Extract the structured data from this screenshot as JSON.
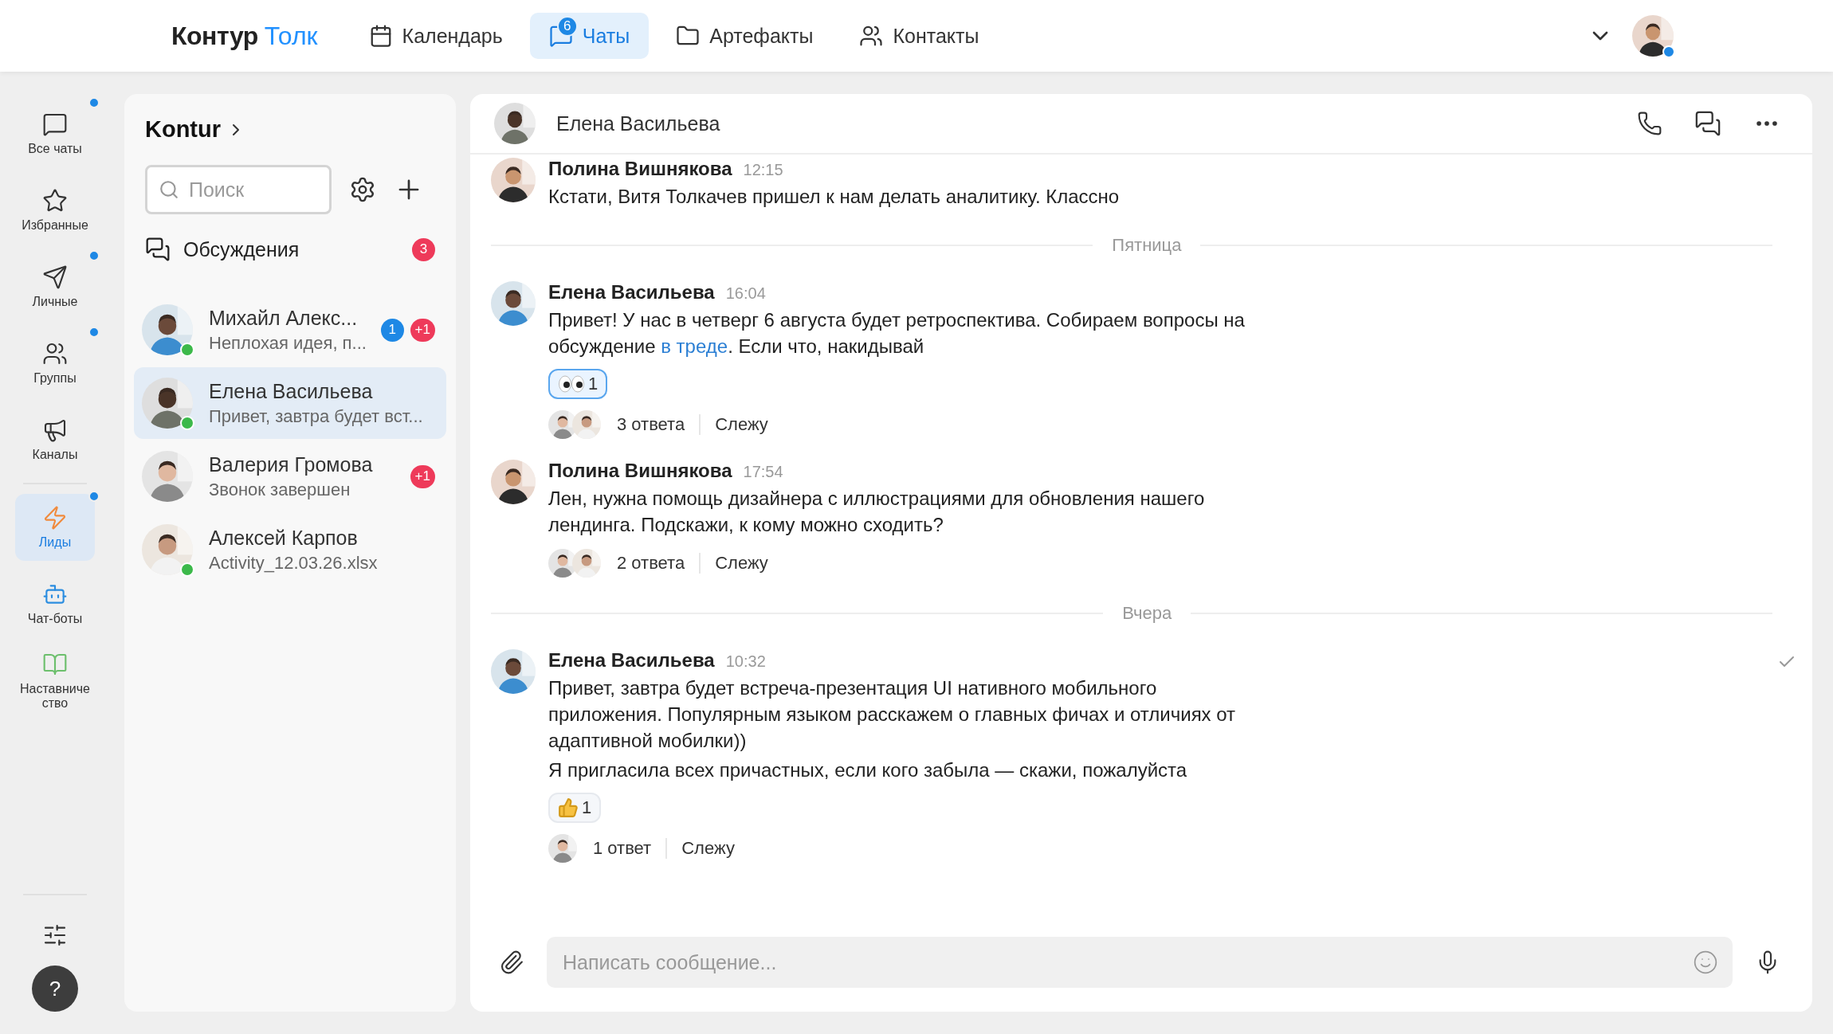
{
  "logo": {
    "primary": "Контур",
    "accent": "Толк"
  },
  "nav": [
    {
      "label": "Календарь",
      "selected": false
    },
    {
      "label": "Чаты",
      "selected": true,
      "badge": "6"
    },
    {
      "label": "Артефакты",
      "selected": false
    },
    {
      "label": "Контакты",
      "selected": false
    }
  ],
  "user": {
    "online": true
  },
  "rail": {
    "items": [
      {
        "label": "Все чаты",
        "selected": false,
        "unread": true
      },
      {
        "label": "Избранные",
        "selected": false,
        "unread": false
      },
      {
        "label": "Личные",
        "selected": false,
        "unread": true
      },
      {
        "label": "Группы",
        "selected": false,
        "unread": true
      },
      {
        "label": "Каналы",
        "selected": false,
        "unread": false
      },
      {
        "label": "Лиды",
        "selected": true,
        "unread": true
      },
      {
        "label": "Чат-боты",
        "selected": false,
        "unread": false
      },
      {
        "label": "Наставничество",
        "selected": false,
        "unread": false
      }
    ],
    "help": "?"
  },
  "chat_list": {
    "workspace": "Kontur",
    "search": {
      "placeholder": "Поиск"
    },
    "discussions": {
      "label": "Обсуждения",
      "count": "3"
    },
    "chats": [
      {
        "name": "Михайл Алекс...",
        "preview": "Неплохая идея, п...",
        "online": true,
        "selected": false,
        "badges": [
          {
            "text": "1",
            "color": "#1e88e5"
          },
          {
            "text": "+1",
            "color": "#ee3a5a"
          }
        ]
      },
      {
        "name": "Елена Васильева",
        "preview": "Привет, завтра будет вст...",
        "online": true,
        "selected": true
      },
      {
        "name": "Валерия Громова",
        "preview": "Звонок завершен",
        "online": false,
        "selected": false,
        "badges": [
          {
            "text": "+1",
            "color": "#ee3a5a"
          }
        ]
      },
      {
        "name": "Алексей Карпов",
        "preview": "Activity_12.03.26.xlsx",
        "online": true,
        "selected": false
      }
    ]
  },
  "chat": {
    "title": "Елена Васильева",
    "feed": [
      {
        "kind": "message",
        "author": "Полина Вишнякова",
        "time": "12:15",
        "paragraphs": [
          {
            "parts": [
              {
                "kind": "text",
                "text": "Кстати, Витя Толкачев пришел к нам делать аналитику. Классно"
              }
            ]
          }
        ]
      },
      {
        "kind": "separator",
        "label": "Пятница"
      },
      {
        "kind": "message",
        "author": "Елена Васильева",
        "time": "16:04",
        "paragraphs": [
          {
            "parts": [
              {
                "kind": "text",
                "text": "Привет! У нас в четверг 6 августа будет ретроспектива. Собираем вопросы на обсуждение "
              },
              {
                "kind": "link",
                "text": "в треде"
              },
              {
                "kind": "text",
                "text": ". Если что, накидывай"
              }
            ]
          }
        ],
        "reactions": [
          {
            "kind": "eyes",
            "count": "1",
            "selected": true
          }
        ],
        "thread": {
          "replies": "3 ответа",
          "follow": "Слежу"
        }
      },
      {
        "kind": "message",
        "author": "Полина Вишнякова",
        "time": "17:54",
        "paragraphs": [
          {
            "parts": [
              {
                "kind": "text",
                "text": "Лен, нужна помощь дизайнера с иллюстрациями для обновления нашего лендинга. Подскажи, к кому можно сходить?"
              }
            ]
          }
        ],
        "thread": {
          "replies": "2 ответа",
          "follow": "Слежу"
        }
      },
      {
        "kind": "separator",
        "label": "Вчера"
      },
      {
        "kind": "message",
        "author": "Елена Васильева",
        "time": "10:32",
        "paragraphs": [
          {
            "parts": [
              {
                "kind": "text",
                "text": "Привет, завтра будет встреча-презентация UI нативного мобильного приложения. Популярным языком расскажем о главных фичах и отличиях от адаптивной мобилки))"
              }
            ]
          },
          {
            "parts": [
              {
                "kind": "text",
                "text": "Я пригласила всех причастных, если кого забыла — скажи, пожалуйста"
              }
            ]
          }
        ],
        "reactions": [
          {
            "kind": "thumbs-up",
            "count": "1",
            "selected": false
          }
        ],
        "thread": {
          "replies": "1 ответ",
          "follow": "Слежу"
        },
        "read": true
      }
    ],
    "composer": {
      "placeholder": "Написать сообщение..."
    }
  }
}
